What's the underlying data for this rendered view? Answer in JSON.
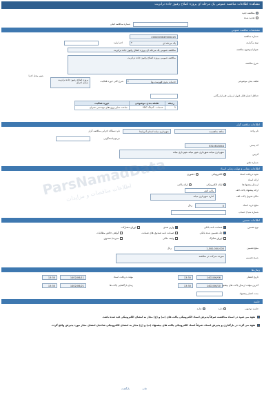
{
  "window": {
    "title": "مشاهده اطلاعات مناقصه عمومی یک مرحله ای پروژه اصلاح رفیوژ جاده ترانزیت"
  },
  "notice_kind": {
    "new_label": "مناقصه جدید",
    "prev_label": "تجدید شده",
    "prev_number_label": "شماره مناقصه قبلی",
    "selected": "new"
  },
  "sections": {
    "general": "مشخصات مناقصه عمومی",
    "organizer": "اطلاعات مناقصه گزار",
    "documents": "اطلاعات نشانی و مهلت زمانی اسناد",
    "deposit": "اطلاعات تضمین",
    "times": "زمان ها",
    "meeting": "جلسه"
  },
  "general": {
    "number_label": "شماره مناقصه",
    "number_value": "2002005649000225",
    "type_label": "نوع برگزاری",
    "type_value": "یک مرحله ای",
    "type_extra_label": "اجرا وارد",
    "title_label": "عنوان/موضوع مناقصه",
    "title_value": "مناقصه عمومی یک مرحله ای پروژه اصلاح رفیوژ جاده ترانزیت",
    "desc_label": "شرح مناقصه",
    "desc_value": "مناقصه عمومی پروژه اصلاح رفیوژ جاده ترانزیت",
    "class_label": "طبقه بندی موضوعی",
    "class_value": "خدمات بدون فهرست بها",
    "place_label": "شرح کلی حوزه فعالیت",
    "place_value": "پروژه اصلاح رفیوژ جاده ترانزیت شامل اجرای",
    "city_label": "شهر محل اجرا",
    "rating_label": "حداقل اعتبار قابل قبول ارزیابی فنی/بازرگانی",
    "rating_value": ""
  },
  "classification_table": {
    "headers": [
      "ردیف",
      "طبقه بندی موضوعی",
      "حوزه فعالیت"
    ],
    "rows": [
      [
        "1",
        "خدمات - کدینگ ISIC",
        "ساخت سایر پروژه‌های مهندسی عمران"
      ]
    ]
  },
  "organizer": {
    "name_label": "نام دستگاه اجرایی مناقصه گزار",
    "name_value": "شهرداری میانه استان آذربایجا",
    "unit_label": "نام واحد",
    "unit_value": "شاهد شاهسمد",
    "ref_label": "مرجع پاسخگویی",
    "ref_value": "",
    "code_label": "کد پستی",
    "code_value": "5314613844",
    "address_label": "آدرس",
    "address_value": "شهرداری میانه-شهرداری شهر میانه شهرداری میانه",
    "tel_label": "شماره تلفن"
  },
  "documents": {
    "recv_label": "نحوه دریافت اسناد",
    "recv_online": "الکترونیکی",
    "recv_offline": "حضوری",
    "place_label": "ارائه اسناد",
    "sub_label": "ارسال پیشنهادها",
    "sub_online": "ارائه الکترونیکی",
    "sub_offline": "ارائه پاکتی",
    "addr_label": "ارائه پیشنهاد پاکت الف",
    "addr_hint": "پاکت الف",
    "other_label": "مکان تحویل پاکت الف",
    "other_value": "اداره شهرداری میانه",
    "fee_label": "مبلغ خرید اسناد",
    "fee_value": "0",
    "fee_unit": "ریال",
    "sell_label": "شماره شبا / حساب",
    "sell_value": ""
  },
  "deposit": {
    "type_label": "نوع تضمین",
    "options": [
      "ضمانت نامه بانکی",
      "واریز نقدی",
      "اوراق مشارکت",
      "چک تضمین شده بانکی",
      "ضمانت نامه صندوق های ضمانت",
      "گواهی خالص مطالبات",
      "اوراق صکوک",
      "وثیقه ملکی",
      "سپرده/ صندوق"
    ],
    "amount_label": "مبلغ تضمین",
    "amount_value": "1,500,000,000",
    "amount_unit": "ریال",
    "desc_label": "شرح تضمین",
    "desc_value": "سپرده شرکت در مناقصه"
  },
  "times": {
    "pub_label": "تاریخ انتشار",
    "pub_date": "1402/06/06",
    "pub_time": "13:30",
    "doc_end_label": "مهلت دریافت اسناد",
    "doc_end_date": "1402/06/11",
    "doc_end_time": "13:30",
    "env_label": "آخرین مهلت ارسال پاکت های پیشنهاد",
    "env_date": "1402/06/20",
    "env_time": "13:30",
    "open_label": "زمان بازگشایی پاکت ها",
    "open_date": "1402/06/21",
    "open_time": "13:30",
    "valid_label": "مدت اعتبار پیشنهاد"
  },
  "meeting": {
    "label": "جلسه توجیهی",
    "yes": "دارد",
    "no": "ندارد"
  },
  "notes": {
    "text1": "تعهد می شود در اسناد مناقصه، صرفاً پذیرش اسناد الکترونیکی پاکت های (ب) و (ج) مجاز به امضای الکترونیکی قید شده باشد.",
    "text2": "تعهد می گردد در بارگذاری و پذیرش اسناد، صرفاً اسناد الکترونیکی پاکت های پیشنهاد (ب) و (ج) مجاز به امضای الکترونیکی صاحبان امضای مجاز مورد پذیرش واقع گردد."
  },
  "footer": {
    "print_label": "چاپ",
    "back_label": "بازگشت"
  },
  "watermark": {
    "brand": "ParsNamadData",
    "sub": "اطلاعات مناقصات و مزایدات"
  },
  "colors": {
    "header": "#2f5f8f",
    "section": "#3e78b0",
    "field_border": "#8aa3bd"
  }
}
